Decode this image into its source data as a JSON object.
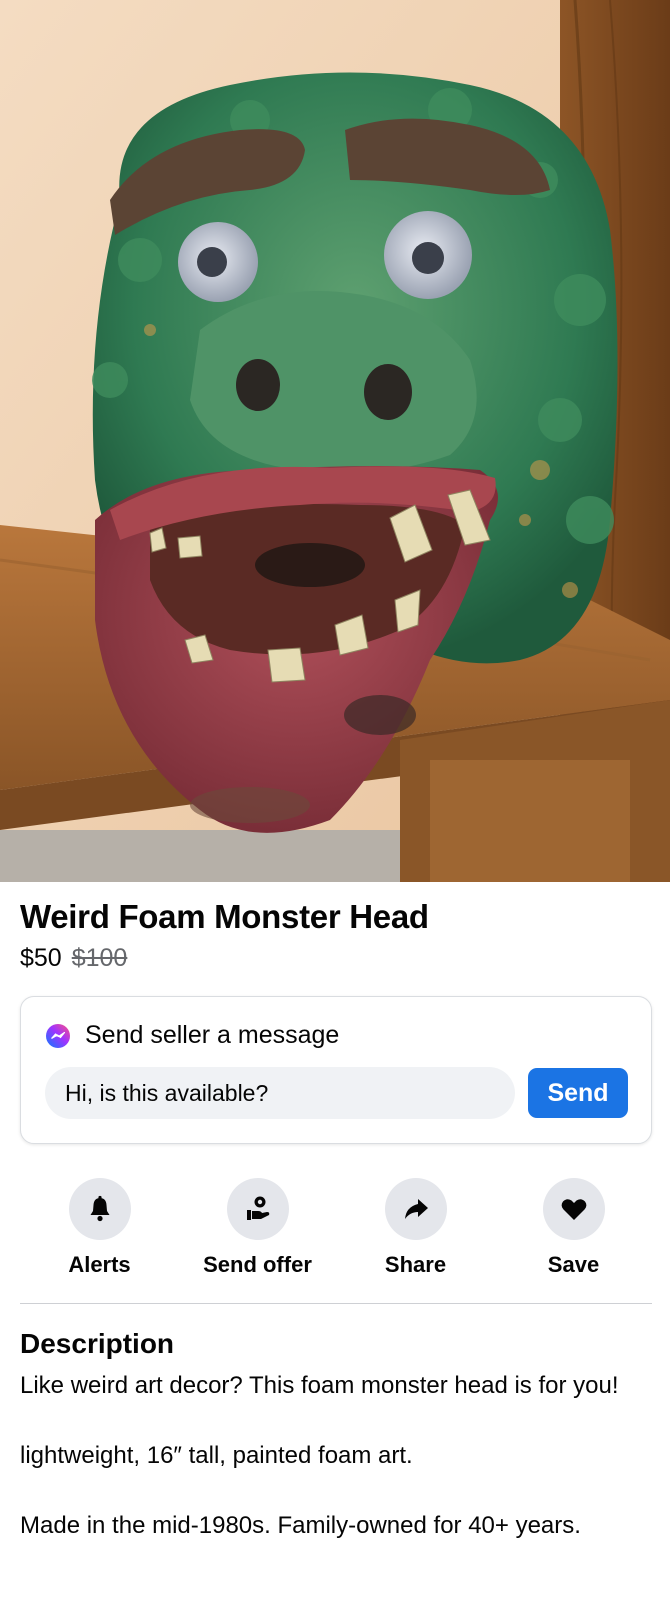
{
  "listing": {
    "title": "Weird Foam Monster Head",
    "price": "$50",
    "original_price": "$100"
  },
  "message": {
    "heading": "Send seller a message",
    "input_value": "Hi, is this available?",
    "send_label": "Send",
    "icon": "messenger-icon"
  },
  "actions": [
    {
      "label": "Alerts",
      "icon": "bell-icon"
    },
    {
      "label": "Send offer",
      "icon": "offer-hand-icon"
    },
    {
      "label": "Share",
      "icon": "share-arrow-icon"
    },
    {
      "label": "Save",
      "icon": "heart-icon"
    }
  ],
  "description": {
    "heading": "Description",
    "paragraphs": [
      "Like weird art decor? This foam monster head is for you!",
      "lightweight, 16″ tall, painted foam art.",
      "Made in the mid-1980s. Family-owned for 40+ years."
    ]
  },
  "colors": {
    "accent": "#1b74e4",
    "text_primary": "#050505",
    "text_secondary": "#65676b",
    "button_bg": "#e4e6eb"
  }
}
